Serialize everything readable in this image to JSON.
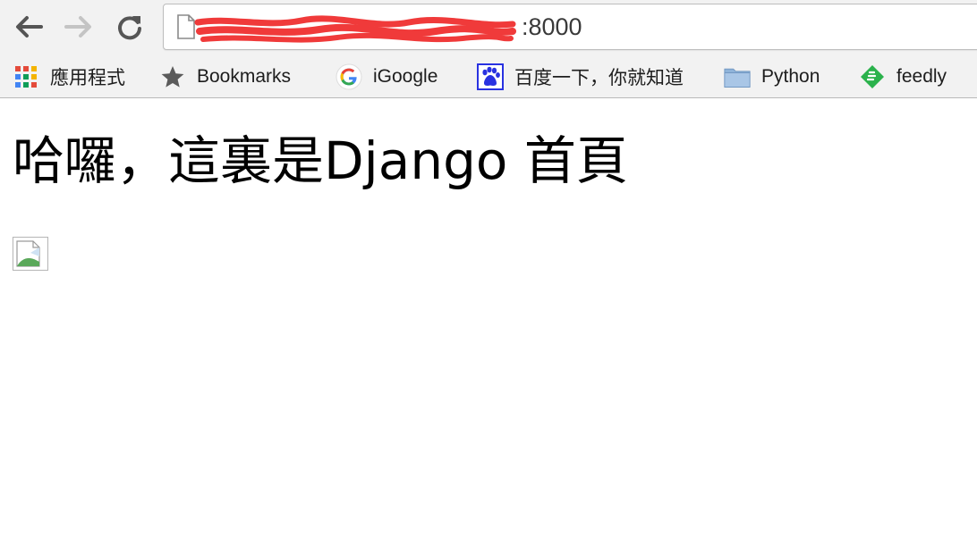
{
  "browser": {
    "url_visible": ":8000"
  },
  "bookmarks": [
    {
      "label": "應用程式",
      "icon": "apps-grid-icon"
    },
    {
      "label": "Bookmarks",
      "icon": "star-icon"
    },
    {
      "label": "iGoogle",
      "icon": "google-g-icon"
    },
    {
      "label": "百度一下，你就知道",
      "icon": "baidu-paw-icon"
    },
    {
      "label": "Python",
      "icon": "folder-icon"
    },
    {
      "label": "feedly",
      "icon": "feedly-icon"
    }
  ],
  "page": {
    "heading": "哈囉，這裏是Django 首頁"
  },
  "colors": {
    "chrome_bg": "#f2f2f2",
    "redaction": "#f03a3a",
    "feedly_green": "#2bb24c",
    "baidu_blue": "#2932e1"
  }
}
